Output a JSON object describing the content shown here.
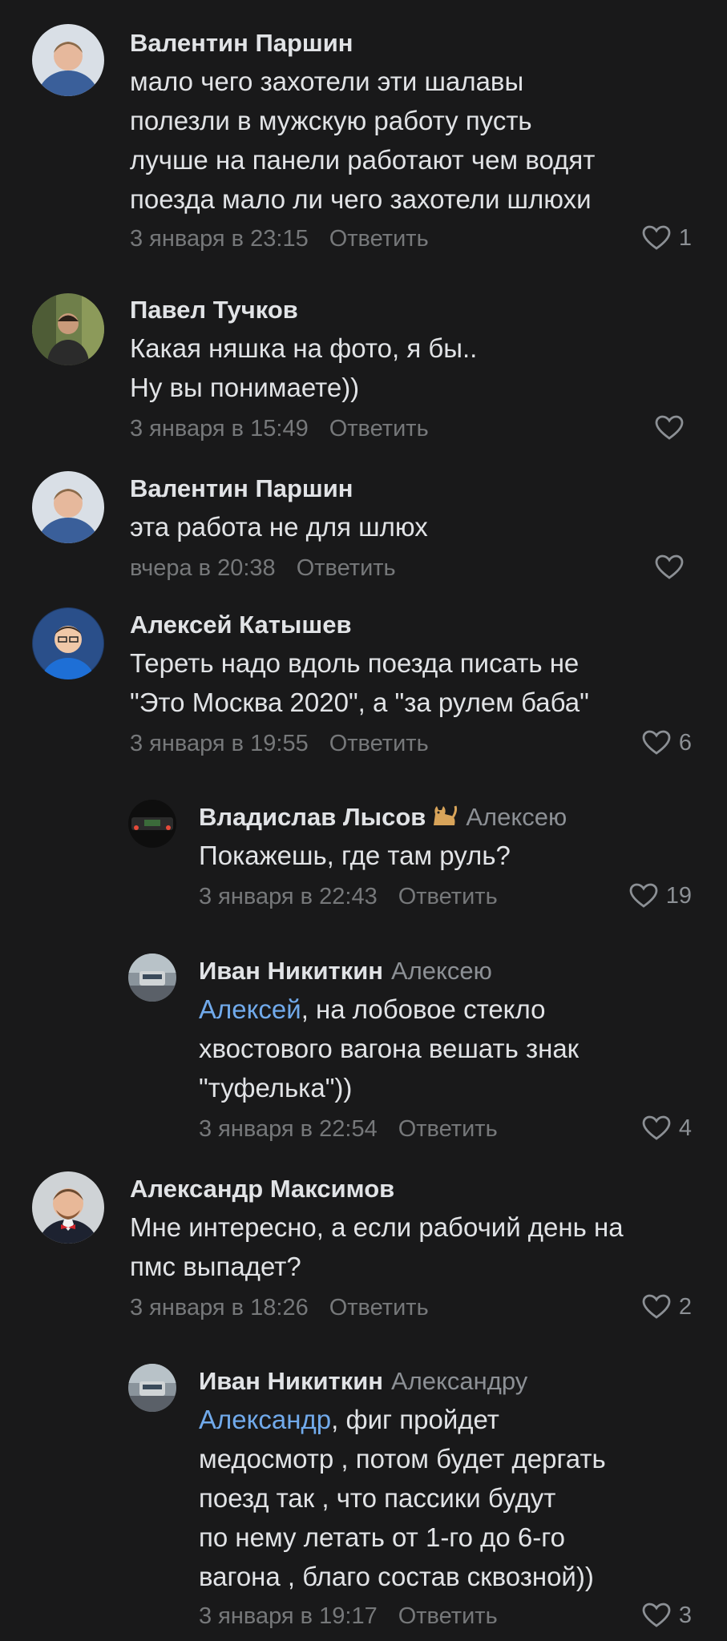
{
  "comments": [
    {
      "author": "Валентин Паршин",
      "reply_to": "",
      "lines": [
        "мало чего захотели эти шалавы",
        "полезли в мужскую работу пусть",
        "лучше на панели работают чем водят",
        "поезда мало ли чего захотели шлюхи"
      ],
      "time": "3 января в 23:15",
      "reply_label": "Ответить",
      "likes": "1"
    },
    {
      "author": "Павел Тучков",
      "reply_to": "",
      "lines": [
        "Какая няшка на фото, я бы..",
        "Ну вы понимаете))"
      ],
      "time": "3 января в 15:49",
      "reply_label": "Ответить",
      "likes": ""
    },
    {
      "author": "Валентин Паршин",
      "reply_to": "",
      "lines": [
        "эта работа не для шлюх"
      ],
      "time": "вчера в 20:38",
      "reply_label": "Ответить",
      "likes": ""
    },
    {
      "author": "Алексей Катышев",
      "reply_to": "",
      "lines": [
        "Тереть надо вдоль поезда писать не",
        "\"Это Москва 2020\", а \"за рулем баба\""
      ],
      "time": "3 января в 19:55",
      "reply_label": "Ответить",
      "likes": "6"
    },
    {
      "author": "Владислав Лысов",
      "reply_to": "Алексею",
      "lines": [
        "Покажешь, где там руль?"
      ],
      "time": "3 января в 22:43",
      "reply_label": "Ответить",
      "likes": "19"
    },
    {
      "author": "Иван Никиткин",
      "reply_to": "Алексею",
      "mention": "Алексей",
      "lines": [
        ", на лобовое стекло",
        "хвостового вагона вешать знак",
        "\"туфелька\"))"
      ],
      "time": "3 января в 22:54",
      "reply_label": "Ответить",
      "likes": "4"
    },
    {
      "author": "Александр Максимов",
      "reply_to": "",
      "lines": [
        "Мне интересно, а если рабочий день на",
        "пмс выпадет?"
      ],
      "time": "3 января в 18:26",
      "reply_label": "Ответить",
      "likes": "2"
    },
    {
      "author": "Иван Никиткин",
      "reply_to": "Александру",
      "mention": "Александр",
      "lines": [
        ", фиг пройдет",
        "медосмотр , потом будет дергать",
        "поезд так , что пассики будут",
        "по нему летать от 1-го до 6-го",
        "вагона , благо состав сквозной))"
      ],
      "time": "3 января в 19:17",
      "reply_label": "Ответить",
      "likes": "3"
    }
  ],
  "colors": {
    "background": "#19191a",
    "text": "#e1e3e6",
    "secondary": "#76787a",
    "mention": "#71aaeb"
  }
}
